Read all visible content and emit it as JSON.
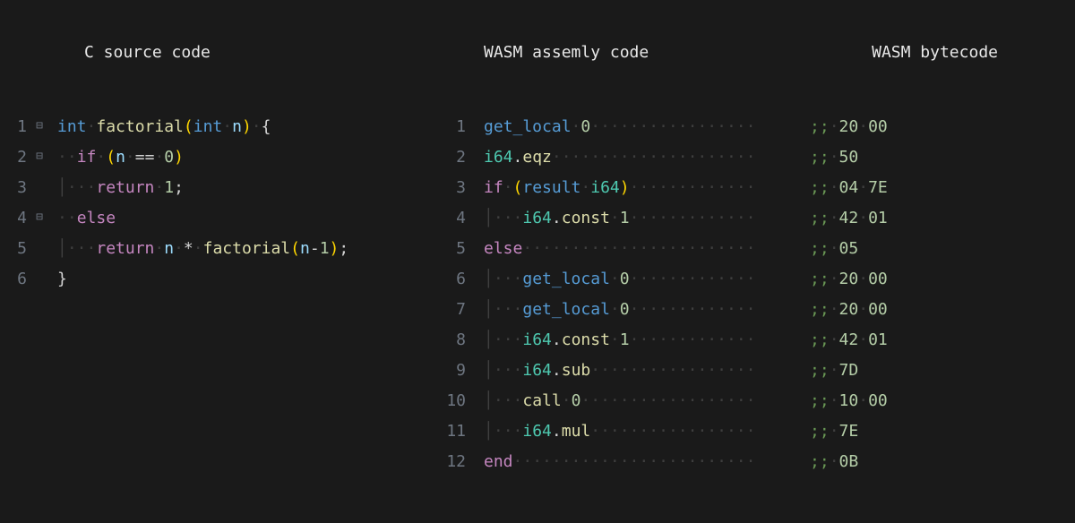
{
  "headings": {
    "c_source": "C source code",
    "wasm_asm": "WASM assemly code",
    "wasm_byte": "WASM bytecode"
  },
  "c_code": {
    "lines": [
      {
        "n": "1",
        "fold": "⊟",
        "tokens": [
          {
            "t": "int",
            "c": "inst"
          },
          {
            "t": " ",
            "c": "ws"
          },
          {
            "t": "factorial",
            "c": "fn"
          },
          {
            "t": "(",
            "c": "paren"
          },
          {
            "t": "int",
            "c": "inst"
          },
          {
            "t": " ",
            "c": "ws"
          },
          {
            "t": "n",
            "c": "ident"
          },
          {
            "t": ")",
            "c": "paren"
          },
          {
            "t": " ",
            "c": "ws"
          },
          {
            "t": "{",
            "c": "op"
          }
        ]
      },
      {
        "n": "2",
        "fold": "⊟",
        "tokens": [
          {
            "t": "∙∙",
            "c": "ws-dot"
          },
          {
            "t": "if",
            "c": "kw"
          },
          {
            "t": " ",
            "c": "ws"
          },
          {
            "t": "(",
            "c": "paren"
          },
          {
            "t": "n",
            "c": "ident"
          },
          {
            "t": " ",
            "c": "ws"
          },
          {
            "t": "==",
            "c": "op"
          },
          {
            "t": " ",
            "c": "ws"
          },
          {
            "t": "0",
            "c": "num"
          },
          {
            "t": ")",
            "c": "paren"
          }
        ]
      },
      {
        "n": "3",
        "fold": "",
        "tokens": [
          {
            "t": "│",
            "c": "guide"
          },
          {
            "t": "∙∙∙",
            "c": "ws-dot"
          },
          {
            "t": "return",
            "c": "kw"
          },
          {
            "t": " ",
            "c": "ws"
          },
          {
            "t": "1",
            "c": "num"
          },
          {
            "t": ";",
            "c": "op"
          }
        ]
      },
      {
        "n": "4",
        "fold": "⊟",
        "tokens": [
          {
            "t": "∙∙",
            "c": "ws-dot"
          },
          {
            "t": "else",
            "c": "kw"
          }
        ]
      },
      {
        "n": "5",
        "fold": "",
        "tokens": [
          {
            "t": "│",
            "c": "guide"
          },
          {
            "t": "∙∙∙",
            "c": "ws-dot"
          },
          {
            "t": "return",
            "c": "kw"
          },
          {
            "t": " ",
            "c": "ws"
          },
          {
            "t": "n",
            "c": "ident"
          },
          {
            "t": " ",
            "c": "ws"
          },
          {
            "t": "*",
            "c": "op"
          },
          {
            "t": " ",
            "c": "ws"
          },
          {
            "t": "factorial",
            "c": "fn"
          },
          {
            "t": "(",
            "c": "paren"
          },
          {
            "t": "n",
            "c": "ident"
          },
          {
            "t": "-",
            "c": "op"
          },
          {
            "t": "1",
            "c": "num"
          },
          {
            "t": ")",
            "c": "paren"
          },
          {
            "t": ";",
            "c": "op"
          }
        ]
      },
      {
        "n": "6",
        "fold": "",
        "tokens": [
          {
            "t": "}",
            "c": "op"
          }
        ]
      }
    ]
  },
  "wasm_code": {
    "lines": [
      {
        "n": "1",
        "indent": "",
        "tokens": [
          {
            "t": "get_local",
            "c": "inst"
          },
          {
            "t": " ",
            "c": "ws"
          },
          {
            "t": "0",
            "c": "num"
          }
        ],
        "bytes": [
          {
            "t": ";;",
            "c": "cmnt"
          },
          {
            "t": " ",
            "c": "ws"
          },
          {
            "t": "20",
            "c": "num"
          },
          {
            "t": " ",
            "c": "ws"
          },
          {
            "t": "00",
            "c": "num"
          }
        ]
      },
      {
        "n": "2",
        "indent": "",
        "tokens": [
          {
            "t": "i64",
            "c": "type"
          },
          {
            "t": ".",
            "c": "op"
          },
          {
            "t": "eqz",
            "c": "fn"
          }
        ],
        "bytes": [
          {
            "t": ";;",
            "c": "cmnt"
          },
          {
            "t": " ",
            "c": "ws"
          },
          {
            "t": "50",
            "c": "num"
          }
        ]
      },
      {
        "n": "3",
        "indent": "",
        "tokens": [
          {
            "t": "if",
            "c": "kw"
          },
          {
            "t": " ",
            "c": "ws"
          },
          {
            "t": "(",
            "c": "paren"
          },
          {
            "t": "result",
            "c": "inst"
          },
          {
            "t": " ",
            "c": "ws"
          },
          {
            "t": "i64",
            "c": "type"
          },
          {
            "t": ")",
            "c": "paren"
          }
        ],
        "bytes": [
          {
            "t": ";;",
            "c": "cmnt"
          },
          {
            "t": " ",
            "c": "ws"
          },
          {
            "t": "04",
            "c": "num"
          },
          {
            "t": " ",
            "c": "ws"
          },
          {
            "t": "7E",
            "c": "num"
          }
        ]
      },
      {
        "n": "4",
        "indent": "│∙∙∙",
        "tokens": [
          {
            "t": "i64",
            "c": "type"
          },
          {
            "t": ".",
            "c": "op"
          },
          {
            "t": "const",
            "c": "fn"
          },
          {
            "t": " ",
            "c": "ws"
          },
          {
            "t": "1",
            "c": "num"
          }
        ],
        "bytes": [
          {
            "t": ";;",
            "c": "cmnt"
          },
          {
            "t": " ",
            "c": "ws"
          },
          {
            "t": "42",
            "c": "num"
          },
          {
            "t": " ",
            "c": "ws"
          },
          {
            "t": "01",
            "c": "num"
          }
        ]
      },
      {
        "n": "5",
        "indent": "",
        "tokens": [
          {
            "t": "else",
            "c": "kw"
          }
        ],
        "bytes": [
          {
            "t": ";;",
            "c": "cmnt"
          },
          {
            "t": " ",
            "c": "ws"
          },
          {
            "t": "05",
            "c": "num"
          }
        ]
      },
      {
        "n": "6",
        "indent": "│∙∙∙",
        "tokens": [
          {
            "t": "get_local",
            "c": "inst"
          },
          {
            "t": " ",
            "c": "ws"
          },
          {
            "t": "0",
            "c": "num"
          }
        ],
        "bytes": [
          {
            "t": ";;",
            "c": "cmnt"
          },
          {
            "t": " ",
            "c": "ws"
          },
          {
            "t": "20",
            "c": "num"
          },
          {
            "t": " ",
            "c": "ws"
          },
          {
            "t": "00",
            "c": "num"
          }
        ]
      },
      {
        "n": "7",
        "indent": "│∙∙∙",
        "tokens": [
          {
            "t": "get_local",
            "c": "inst"
          },
          {
            "t": " ",
            "c": "ws"
          },
          {
            "t": "0",
            "c": "num"
          }
        ],
        "bytes": [
          {
            "t": ";;",
            "c": "cmnt"
          },
          {
            "t": " ",
            "c": "ws"
          },
          {
            "t": "20",
            "c": "num"
          },
          {
            "t": " ",
            "c": "ws"
          },
          {
            "t": "00",
            "c": "num"
          }
        ]
      },
      {
        "n": "8",
        "indent": "│∙∙∙",
        "tokens": [
          {
            "t": "i64",
            "c": "type"
          },
          {
            "t": ".",
            "c": "op"
          },
          {
            "t": "const",
            "c": "fn"
          },
          {
            "t": " ",
            "c": "ws"
          },
          {
            "t": "1",
            "c": "num"
          }
        ],
        "bytes": [
          {
            "t": ";;",
            "c": "cmnt"
          },
          {
            "t": " ",
            "c": "ws"
          },
          {
            "t": "42",
            "c": "num"
          },
          {
            "t": " ",
            "c": "ws"
          },
          {
            "t": "01",
            "c": "num"
          }
        ]
      },
      {
        "n": "9",
        "indent": "│∙∙∙",
        "tokens": [
          {
            "t": "i64",
            "c": "type"
          },
          {
            "t": ".",
            "c": "op"
          },
          {
            "t": "sub",
            "c": "fn"
          }
        ],
        "bytes": [
          {
            "t": ";;",
            "c": "cmnt"
          },
          {
            "t": " ",
            "c": "ws"
          },
          {
            "t": "7D",
            "c": "num"
          }
        ]
      },
      {
        "n": "10",
        "indent": "│∙∙∙",
        "tokens": [
          {
            "t": "call",
            "c": "fn"
          },
          {
            "t": " ",
            "c": "ws"
          },
          {
            "t": "0",
            "c": "num"
          }
        ],
        "bytes": [
          {
            "t": ";;",
            "c": "cmnt"
          },
          {
            "t": " ",
            "c": "ws"
          },
          {
            "t": "10",
            "c": "num"
          },
          {
            "t": " ",
            "c": "ws"
          },
          {
            "t": "00",
            "c": "num"
          }
        ]
      },
      {
        "n": "11",
        "indent": "│∙∙∙",
        "tokens": [
          {
            "t": "i64",
            "c": "type"
          },
          {
            "t": ".",
            "c": "op"
          },
          {
            "t": "mul",
            "c": "fn"
          }
        ],
        "bytes": [
          {
            "t": ";;",
            "c": "cmnt"
          },
          {
            "t": " ",
            "c": "ws"
          },
          {
            "t": "7E",
            "c": "num"
          }
        ]
      },
      {
        "n": "12",
        "indent": "",
        "tokens": [
          {
            "t": "end",
            "c": "kw"
          }
        ],
        "bytes": [
          {
            "t": ";;",
            "c": "cmnt"
          },
          {
            "t": " ",
            "c": "ws"
          },
          {
            "t": "0B",
            "c": "num"
          }
        ]
      }
    ]
  }
}
